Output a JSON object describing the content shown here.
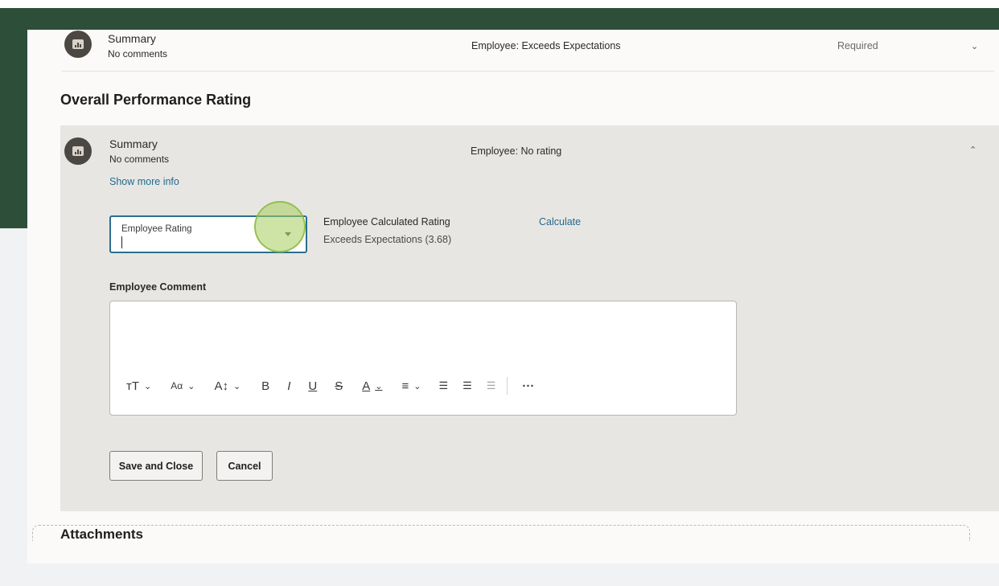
{
  "goal_row": {
    "title": "Summary",
    "comments": "No comments",
    "rating": "Employee: Exceeds Expectations",
    "status": "Required",
    "chevron": "chevron-down-icon"
  },
  "overall": {
    "heading": "Overall Performance Rating",
    "summary": {
      "title": "Summary",
      "comments": "No comments",
      "rating": "Employee: No rating",
      "chevron": "chevron-up-icon",
      "show_more": "Show more info"
    },
    "employee_rating": {
      "label": "Employee Rating",
      "value": ""
    },
    "calculated": {
      "label": "Employee Calculated Rating",
      "value": "Exceeds Expectations (3.68)",
      "action": "Calculate"
    },
    "comment": {
      "label": "Employee Comment",
      "value": ""
    },
    "toolbar": {
      "text_size": "ᴛT",
      "font": "Aα",
      "line_height": "A↕",
      "bold": "B",
      "italic": "I",
      "underline": "U",
      "strike": "S",
      "color": "A",
      "align": "≡",
      "bullets": "☰",
      "numbers": "☰",
      "outdent": "☰",
      "more": "···"
    },
    "save_label": "Save and Close",
    "cancel_label": "Cancel"
  },
  "attachments": {
    "heading": "Attachments"
  },
  "colors": {
    "header": "#2d4f3a",
    "link": "#1f6b8c",
    "panel": "#e8e6e3",
    "focus": "#2a6f8e"
  }
}
